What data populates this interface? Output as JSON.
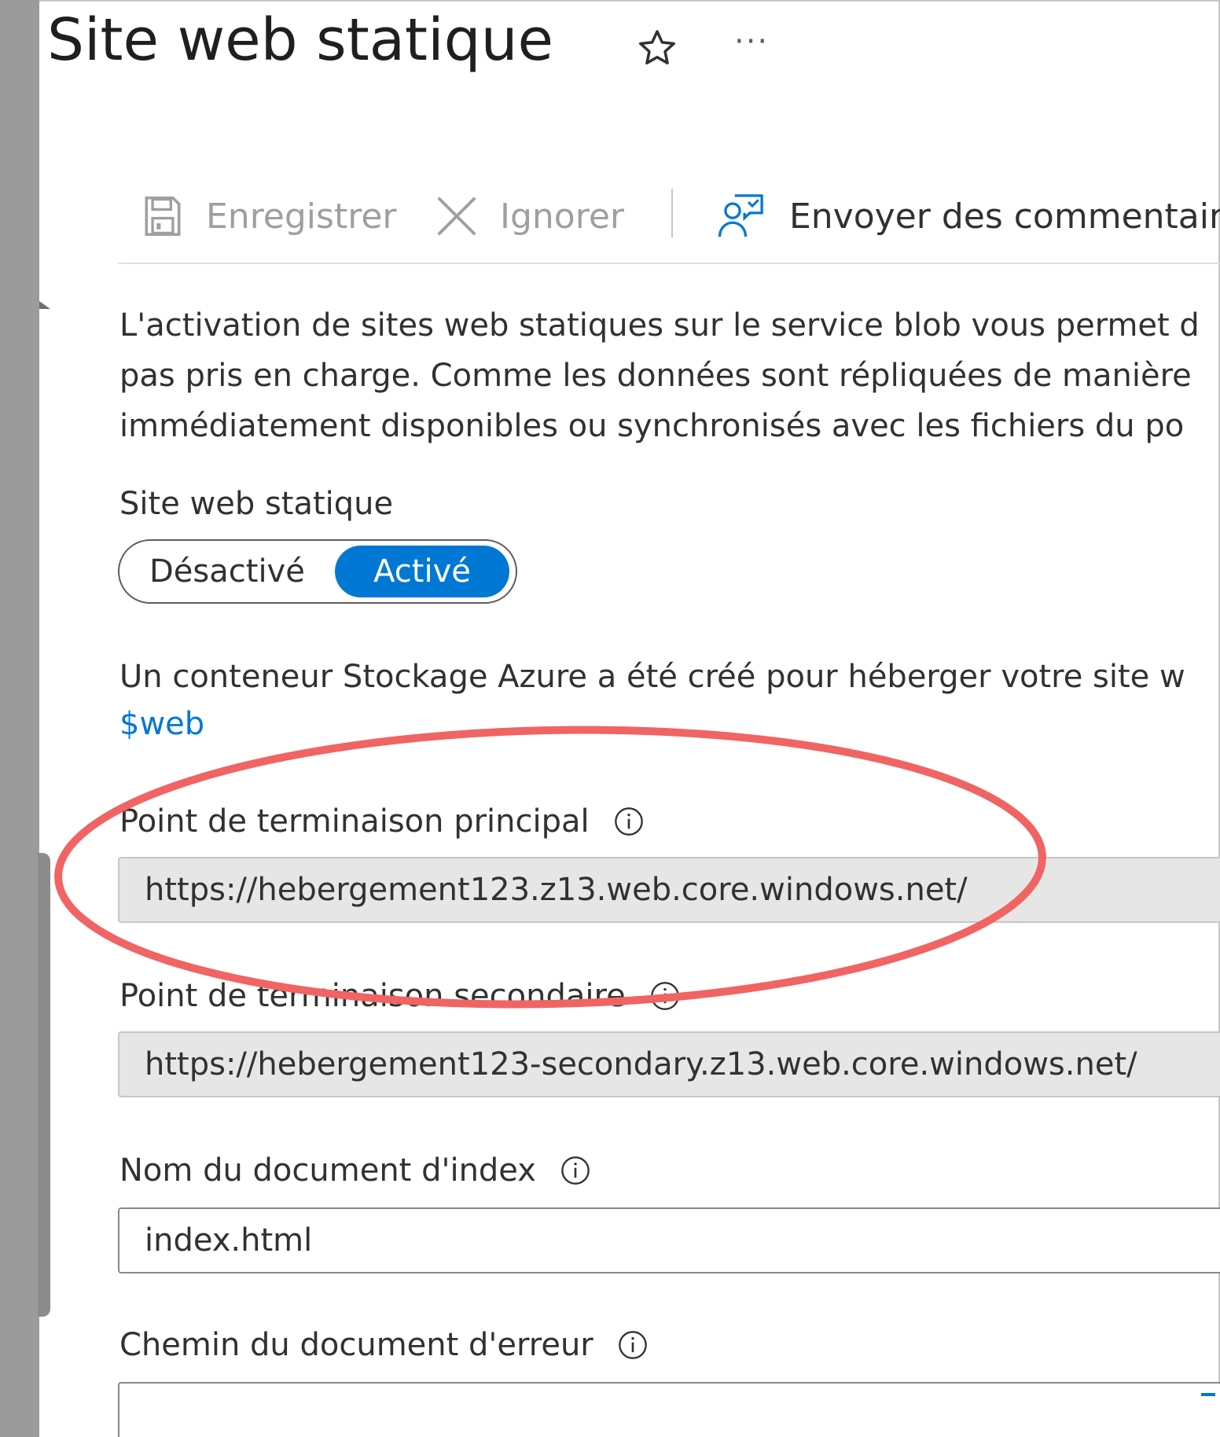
{
  "header": {
    "title": "Site web statique",
    "star_icon": "star-outline-icon",
    "more_icon": "more-ellipsis-icon",
    "more_label": "···"
  },
  "toolbar": {
    "save_label": "Enregistrer",
    "save_icon": "save-floppy-icon",
    "discard_label": "Ignorer",
    "discard_icon": "close-x-icon",
    "feedback_label": "Envoyer des commentaires",
    "feedback_icon": "feedback-person-icon"
  },
  "description": {
    "line1": "L'activation de sites web statiques sur le service blob vous permet d",
    "line2": "pas pris en charge. Comme les données sont répliquées de manière",
    "line3": "immédiatement disponibles ou synchronisés avec les fichiers du po"
  },
  "static_site": {
    "label": "Site web statique",
    "toggle_off_label": "Désactivé",
    "toggle_on_label": "Activé",
    "selected": "Activé"
  },
  "container": {
    "note": "Un conteneur Stockage Azure a été créé pour héberger votre site w",
    "link": "$web"
  },
  "primary_endpoint": {
    "label": "Point de terminaison principal",
    "value": "https://hebergement123.z13.web.core.windows.net/"
  },
  "secondary_endpoint": {
    "label": "Point de terminaison secondaire",
    "value": "https://hebergement123-secondary.z13.web.core.windows.net/"
  },
  "index_document": {
    "label": "Nom du document d'index",
    "value": "index.html"
  },
  "error_document": {
    "label": "Chemin du document d'erreur",
    "value": ""
  },
  "colors": {
    "accent": "#0078d4",
    "annotation": "#f06464",
    "readonly_field": "#e6e6e6"
  }
}
